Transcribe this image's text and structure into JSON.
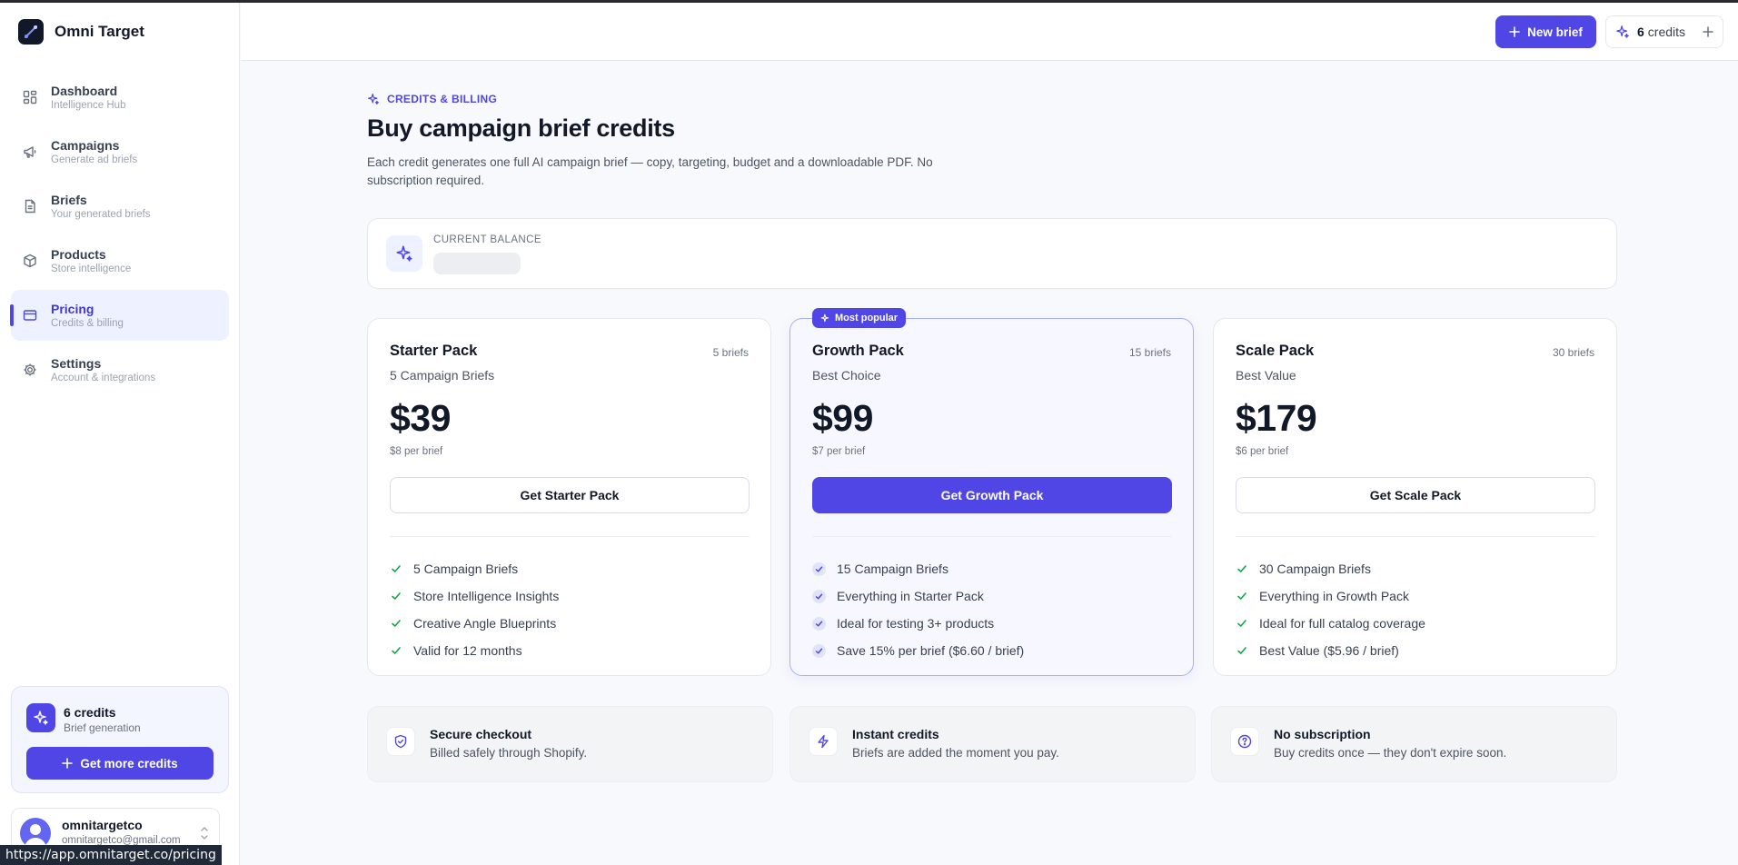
{
  "app": {
    "name": "Omni Target"
  },
  "nav": [
    {
      "label": "Dashboard",
      "sub": "Intelligence Hub",
      "icon": "dashboard-icon"
    },
    {
      "label": "Campaigns",
      "sub": "Generate ad briefs",
      "icon": "megaphone-icon"
    },
    {
      "label": "Briefs",
      "sub": "Your generated briefs",
      "icon": "document-icon"
    },
    {
      "label": "Products",
      "sub": "Store intelligence",
      "icon": "box-icon"
    },
    {
      "label": "Pricing",
      "sub": "Credits & billing",
      "icon": "card-icon",
      "active": true
    },
    {
      "label": "Settings",
      "sub": "Account & integrations",
      "icon": "gear-icon"
    }
  ],
  "sidebar_credits": {
    "count": "6 credits",
    "sub": "Brief generation",
    "button": "Get more credits"
  },
  "user": {
    "name": "omnitargetco",
    "email": "omnitargetco@gmail.com"
  },
  "status_url": "https://app.omnitarget.co/pricing",
  "topbar": {
    "new_brief": "New brief",
    "credits_num": "6",
    "credits_label": "credits"
  },
  "header": {
    "eyebrow": "CREDITS & BILLING",
    "title": "Buy campaign brief credits",
    "description": "Each credit generates one full AI campaign brief — copy, targeting, budget and a downloadable PDF. No subscription required."
  },
  "balance": {
    "label": "CURRENT BALANCE"
  },
  "plans": [
    {
      "name": "Starter Pack",
      "count": "5 briefs",
      "sub": "5 Campaign Briefs",
      "price": "$39",
      "per": "$8 per brief",
      "button": "Get Starter Pack",
      "features": [
        "5 Campaign Briefs",
        "Store Intelligence Insights",
        "Creative Angle Blueprints",
        "Valid for 12 months"
      ]
    },
    {
      "name": "Growth Pack",
      "count": "15 briefs",
      "sub": "Best Choice",
      "badge": "Most popular",
      "price": "$99",
      "per": "$7 per brief",
      "button": "Get Growth Pack",
      "features": [
        "15 Campaign Briefs",
        "Everything in Starter Pack",
        "Ideal for testing 3+ products",
        "Save 15% per brief ($6.60 / brief)"
      ]
    },
    {
      "name": "Scale Pack",
      "count": "30 briefs",
      "sub": "Best Value",
      "price": "$179",
      "per": "$6 per brief",
      "button": "Get Scale Pack",
      "features": [
        "30 Campaign Briefs",
        "Everything in Growth Pack",
        "Ideal for full catalog coverage",
        "Best Value ($5.96 / brief)"
      ]
    }
  ],
  "info": [
    {
      "title": "Secure checkout",
      "sub": "Billed safely through Shopify.",
      "icon": "shield-icon"
    },
    {
      "title": "Instant credits",
      "sub": "Briefs are added the moment you pay.",
      "icon": "lightning-icon"
    },
    {
      "title": "No subscription",
      "sub": "Buy credits once — they don't expire soon.",
      "icon": "help-icon"
    }
  ],
  "colors": {
    "accent": "#4f46e5",
    "check_green": "#16a34a",
    "text": "#111827",
    "muted": "#6b7280"
  }
}
